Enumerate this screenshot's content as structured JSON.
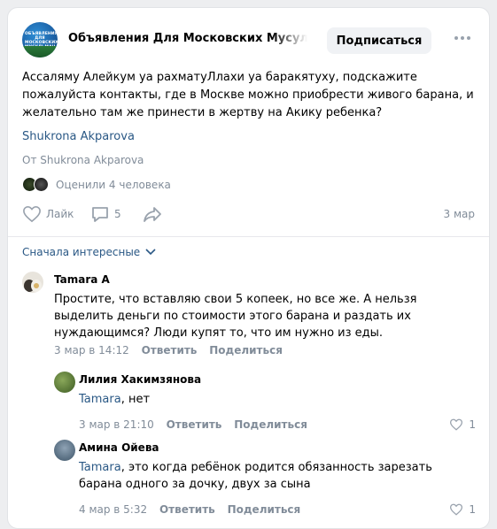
{
  "group": {
    "name": "Объявления Для Московских Мусульман",
    "avatar_text": "ОБЪЯВЛЕНИЯ ДЛЯ МОСКОВСКИХ МУСУЛЬМАН",
    "subscribe_label": "Подписаться"
  },
  "post": {
    "text": "Ассаляму Алейкум уа рахматуЛлахи уа баракятуху, подскажите пожалуйста контакты, где в Москве можно приобрести живого барана, и желательно там же принести в жертву на Акику ребенка?",
    "author_link": "Shukrona Akparova",
    "from_line": "От Shukrona Akparova",
    "liked_text": "Оценили 4 человека",
    "like_label": "Лайк",
    "comments_count": "5",
    "date": "3 мар"
  },
  "comments_sort": "Сначала интересные",
  "comments": [
    {
      "name": "Tamara A",
      "text": "Простите, что вставляю свои 5 копеек, но все же. А нельзя выделить деньги по стоимости этого барана и раздать их нуждающимся? Люди купят то, что им нужно из еды.",
      "date": "3 мар в 14:12",
      "reply": "Ответить",
      "share": "Поделиться"
    },
    {
      "name": "Лилия Хакимзянова",
      "mention": "Tamara",
      "text": ", нет",
      "date": "3 мар в 21:10",
      "reply": "Ответить",
      "share": "Поделиться",
      "likes": "1"
    },
    {
      "name": "Амина Ойева",
      "mention": "Tamara",
      "text": ", это когда ребёнок родится обязанность зарезать барана одного за дочку, двух за сына",
      "date": "4 мар в 5:32",
      "reply": "Ответить",
      "share": "Поделиться",
      "likes": "1"
    }
  ],
  "colors": {
    "link": "#2a5885",
    "secondary": "#818c99",
    "background": "#edeef0"
  }
}
